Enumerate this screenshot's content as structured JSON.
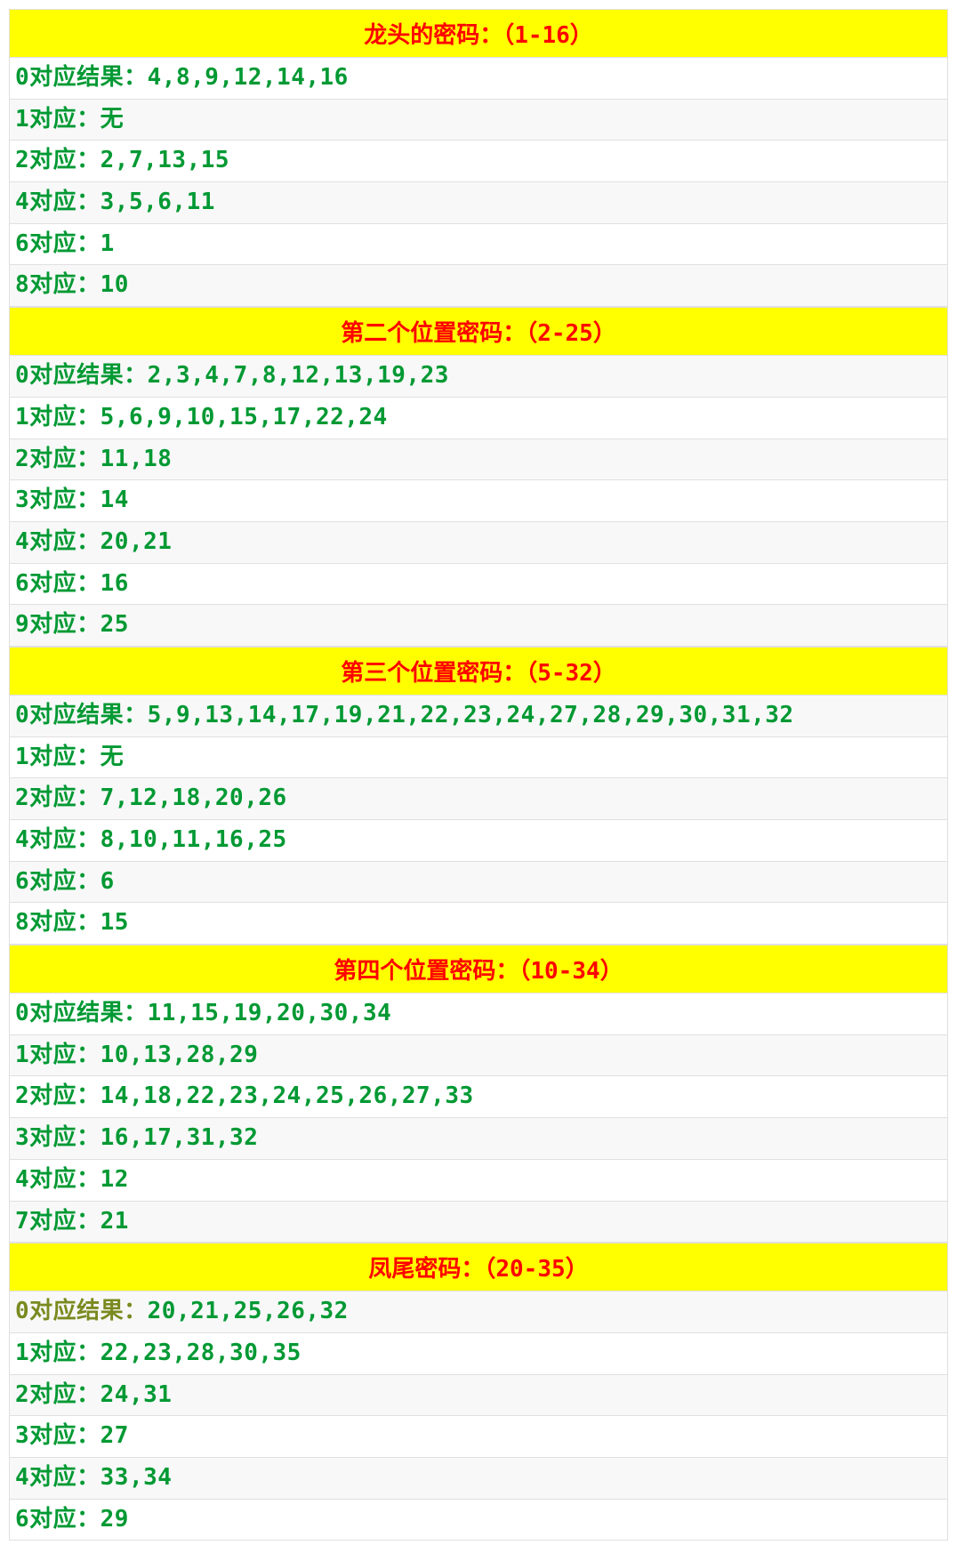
{
  "sections": [
    {
      "title": "龙头的密码：（1-16）",
      "rows": [
        {
          "label": "0对应结果：",
          "values": "4,8,9,12,14,16"
        },
        {
          "label": "1对应：",
          "values": "无"
        },
        {
          "label": "2对应：",
          "values": "2,7,13,15"
        },
        {
          "label": "4对应：",
          "values": "3,5,6,11"
        },
        {
          "label": "6对应：",
          "values": "1"
        },
        {
          "label": "8对应：",
          "values": "10"
        }
      ]
    },
    {
      "title": "第二个位置密码：（2-25）",
      "rows": [
        {
          "label": "0对应结果：",
          "values": "2,3,4,7,8,12,13,19,23"
        },
        {
          "label": "1对应：",
          "values": "5,6,9,10,15,17,22,24"
        },
        {
          "label": "2对应：",
          "values": "11,18"
        },
        {
          "label": "3对应：",
          "values": "14"
        },
        {
          "label": "4对应：",
          "values": "20,21"
        },
        {
          "label": "6对应：",
          "values": "16"
        },
        {
          "label": "9对应：",
          "values": "25"
        }
      ]
    },
    {
      "title": "第三个位置密码：（5-32）",
      "rows": [
        {
          "label": "0对应结果：",
          "values": "5,9,13,14,17,19,21,22,23,24,27,28,29,30,31,32"
        },
        {
          "label": "1对应：",
          "values": "无"
        },
        {
          "label": "2对应：",
          "values": "7,12,18,20,26"
        },
        {
          "label": "4对应：",
          "values": "8,10,11,16,25"
        },
        {
          "label": "6对应：",
          "values": "6"
        },
        {
          "label": "8对应：",
          "values": "15"
        }
      ]
    },
    {
      "title": "第四个位置密码：（10-34）",
      "rows": [
        {
          "label": "0对应结果：",
          "values": "11,15,19,20,30,34"
        },
        {
          "label": "1对应：",
          "values": "10,13,28,29"
        },
        {
          "label": "2对应：",
          "values": "14,18,22,23,24,25,26,27,33"
        },
        {
          "label": "3对应：",
          "values": "16,17,31,32"
        },
        {
          "label": "4对应：",
          "values": "12"
        },
        {
          "label": "7对应：",
          "values": "21"
        }
      ]
    },
    {
      "title": "凤尾密码：（20-35）",
      "rows": [
        {
          "label": "0对应结果：",
          "values": "20,21,25,26,32",
          "muted": true
        },
        {
          "label": "1对应：",
          "values": "22,23,28,30,35"
        },
        {
          "label": "2对应：",
          "values": "24,31"
        },
        {
          "label": "3对应：",
          "values": "27"
        },
        {
          "label": "4对应：",
          "values": "33,34"
        },
        {
          "label": "6对应：",
          "values": "29"
        }
      ]
    }
  ]
}
